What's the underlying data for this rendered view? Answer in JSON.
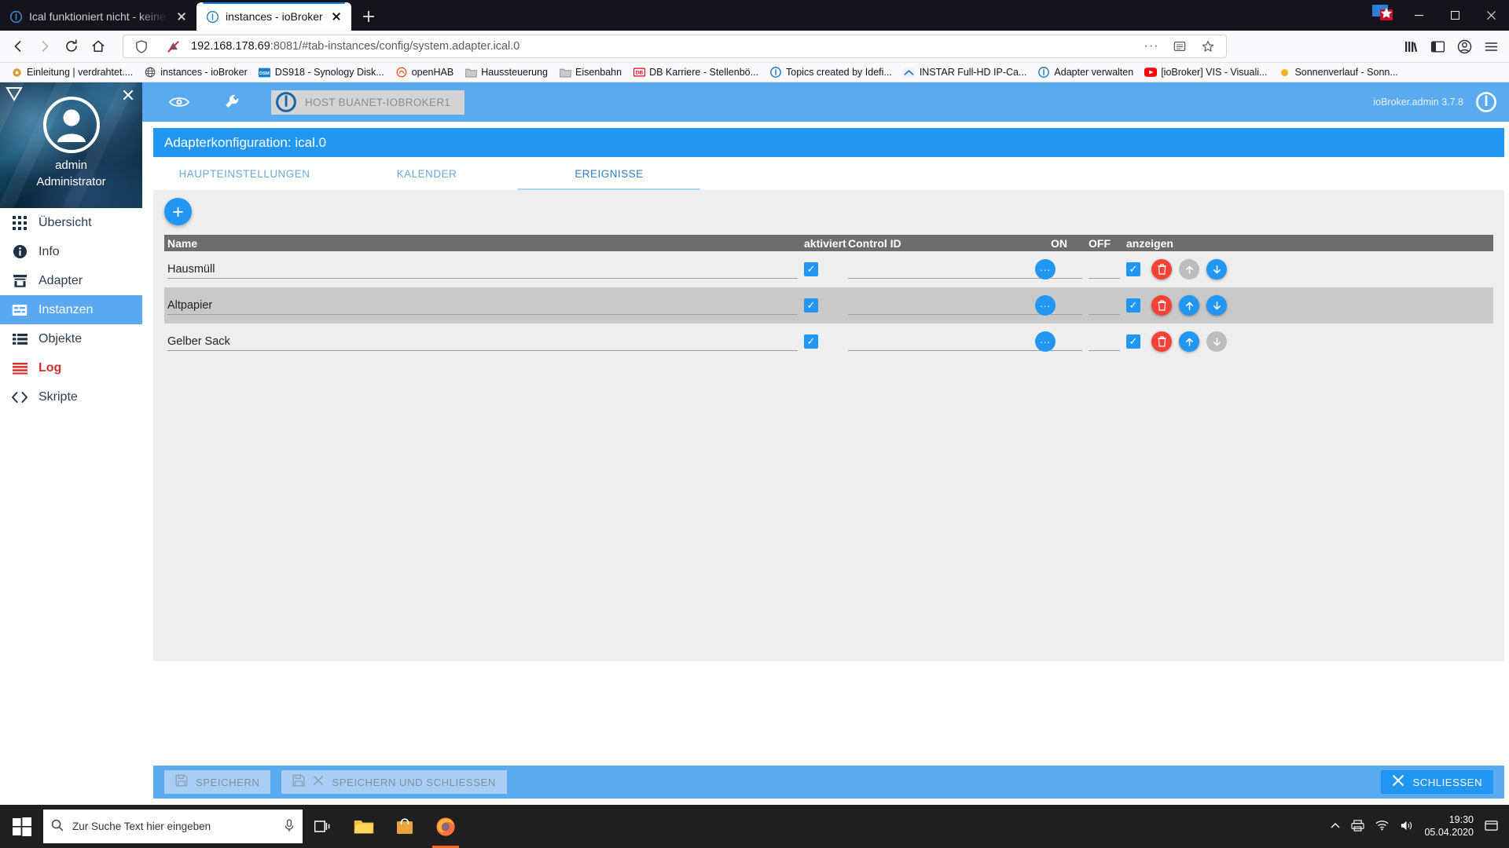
{
  "browser": {
    "tabs": [
      {
        "title": "Ical funktioniert nicht - keine E...",
        "icon": "iobroker-icon",
        "active": false
      },
      {
        "title": "instances - ioBroker",
        "icon": "iobroker-icon",
        "active": true
      }
    ],
    "new_tab_label": "+",
    "nav": {
      "back": "←",
      "forward": "→",
      "reload": "⟳",
      "home": "⌂",
      "shield_icon": "shield-icon",
      "permission_icon": "blocked-permission-icon",
      "url_host": "192.168.178.69",
      "url_rest": ":8081/#tab-instances/config/system.adapter.ical.0",
      "page_actions": "···",
      "reader_icon": "reader-view-icon",
      "bookmark_icon": "★",
      "library_icon": "library-icon",
      "sidebar_icon": "sidebar-icon",
      "account_icon": "account-icon",
      "menu_icon": "≡"
    },
    "bookmarks": [
      {
        "label": "Einleitung | verdrahtet....",
        "icon": "gear-favicon"
      },
      {
        "label": "instances - ioBroker",
        "icon": "globe-favicon"
      },
      {
        "label": "DS918 - Synology Disk...",
        "icon": "dsm-favicon"
      },
      {
        "label": "openHAB",
        "icon": "openhab-favicon"
      },
      {
        "label": "Haussteuerung",
        "icon": "folder-icon"
      },
      {
        "label": "Eisenbahn",
        "icon": "folder-icon"
      },
      {
        "label": "DB Karriere - Stellenbö...",
        "icon": "db-favicon"
      },
      {
        "label": "Topics created by Idefi...",
        "icon": "iobroker-icon"
      },
      {
        "label": "INSTAR Full-HD IP-Ca...",
        "icon": "instar-favicon"
      },
      {
        "label": "Adapter verwalten",
        "icon": "iobroker-icon"
      },
      {
        "label": "[ioBroker] VIS - Visuali...",
        "icon": "youtube-favicon"
      },
      {
        "label": "Sonnenverlauf - Sonn...",
        "icon": "sun-favicon"
      }
    ],
    "window_controls": {
      "minimize": "—",
      "maximize": "☐",
      "close": "✕"
    }
  },
  "sidebar": {
    "collapse_icon": "collapse-triangle-icon",
    "close_icon": "close-icon",
    "avatar_icon": "user-avatar-icon",
    "user_name": "admin",
    "user_role": "Administrator",
    "items": [
      {
        "label": "Übersicht",
        "icon": "grid-icon",
        "selected": false,
        "danger": false
      },
      {
        "label": "Info",
        "icon": "info-icon",
        "selected": false,
        "danger": false
      },
      {
        "label": "Adapter",
        "icon": "store-icon",
        "selected": false,
        "danger": false
      },
      {
        "label": "Instanzen",
        "icon": "instances-icon",
        "selected": true,
        "danger": false
      },
      {
        "label": "Objekte",
        "icon": "list-icon",
        "selected": false,
        "danger": false
      },
      {
        "label": "Log",
        "icon": "log-lines-icon",
        "selected": false,
        "danger": true
      },
      {
        "label": "Skripte",
        "icon": "code-brackets-icon",
        "selected": false,
        "danger": false
      }
    ]
  },
  "topbar": {
    "eye_icon": "eye-icon",
    "wrench_icon": "wrench-icon",
    "host_label": "HOST BUANET-IOBROKER1",
    "host_logo": "iobroker-logo-icon",
    "version": "ioBroker.admin 3.7.8",
    "power_icon": "power-icon"
  },
  "config": {
    "title": "Adapterkonfiguration: ical.0",
    "tabs": [
      {
        "label": "HAUPTEINSTELLUNGEN",
        "active": false
      },
      {
        "label": "KALENDER",
        "active": false
      },
      {
        "label": "EREIGNISSE",
        "active": true
      }
    ],
    "add_button_label": "+",
    "columns": [
      {
        "key": "name",
        "label": "Name"
      },
      {
        "key": "enabled",
        "label": "aktiviert"
      },
      {
        "key": "control_id",
        "label": "Control ID"
      },
      {
        "key": "on",
        "label": "ON"
      },
      {
        "key": "off",
        "label": "OFF"
      },
      {
        "key": "display",
        "label": "anzeigen"
      },
      {
        "key": "actions",
        "label": ""
      }
    ],
    "rows": [
      {
        "name": "Hausmüll",
        "enabled": true,
        "control_id": "",
        "on": "",
        "off": "",
        "display": true,
        "browse_label": "...",
        "delete_icon": "trash-icon",
        "up_icon": "arrow-up-icon",
        "down_icon": "arrow-down-icon",
        "up_enabled": false,
        "down_enabled": true,
        "alt": false
      },
      {
        "name": "Altpapier",
        "enabled": true,
        "control_id": "",
        "on": "",
        "off": "",
        "display": true,
        "browse_label": "...",
        "delete_icon": "trash-icon",
        "up_icon": "arrow-up-icon",
        "down_icon": "arrow-down-icon",
        "up_enabled": true,
        "down_enabled": true,
        "alt": true
      },
      {
        "name": "Gelber Sack",
        "enabled": true,
        "control_id": "",
        "on": "",
        "off": "",
        "display": true,
        "browse_label": "...",
        "delete_icon": "trash-icon",
        "up_icon": "arrow-up-icon",
        "down_icon": "arrow-down-icon",
        "up_enabled": true,
        "down_enabled": false,
        "alt": false
      }
    ]
  },
  "footer": {
    "save_label": "SPEICHERN",
    "save_icon": "save-icon",
    "save_close_label": "SPEICHERN UND SCHLIESSEN",
    "save_close_icon": "save-icon",
    "save_close_x_icon": "close-icon",
    "close_label": "SCHLIESSEN",
    "close_icon": "close-icon"
  },
  "taskbar": {
    "start_icon": "windows-start-icon",
    "search_placeholder": "Zur Suche Text hier eingeben",
    "search_icon": "search-icon",
    "mic_icon": "microphone-icon",
    "taskview_icon": "task-view-icon",
    "apps": [
      {
        "icon": "file-explorer-icon",
        "active": false
      },
      {
        "icon": "store-icon",
        "active": false
      },
      {
        "icon": "firefox-icon",
        "active": true
      }
    ],
    "tray": {
      "chevron": "^",
      "printer_icon": "printer-icon",
      "network_icon": "network-icon",
      "volume_icon": "volume-icon",
      "time": "19:30",
      "date": "05.04.2020",
      "notification_icon": "notification-icon"
    }
  },
  "colors": {
    "accent_blue": "#2196f3",
    "header_blue": "#5aaaf0",
    "danger_red": "#d32f2f",
    "table_header_gray": "#6d6d6d"
  }
}
